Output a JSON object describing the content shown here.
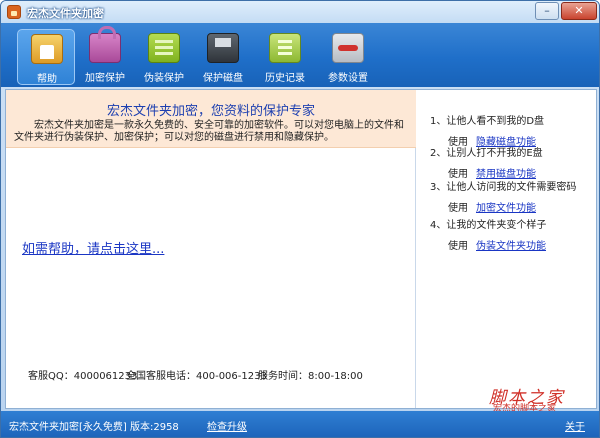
{
  "window": {
    "title": "宏杰文件夹加密"
  },
  "toolbar": {
    "items": [
      {
        "label": "帮助",
        "icon": "home-icon"
      },
      {
        "label": "加密保护",
        "icon": "lock-icon"
      },
      {
        "label": "伪装保护",
        "icon": "book-icon"
      },
      {
        "label": "保护磁盘",
        "icon": "disk-icon"
      },
      {
        "label": "历史记录",
        "icon": "history-icon"
      },
      {
        "label": "参数设置",
        "icon": "toolbox-icon"
      }
    ]
  },
  "banner": {
    "title": "宏杰文件夹加密，您资料的保护专家",
    "text": "宏杰文件夹加密是一款永久免费的、安全可靠的加密软件。可以对您电脑上的文件和文件夹进行伪装保护、加密保护；可以对您的磁盘进行禁用和隐藏保护。"
  },
  "help_link": "如需帮助，请点击这里...",
  "contact": {
    "qq": "客服QQ：4000061233",
    "phone": "全国客服电话：400-006-1233",
    "hours": "服务时间：8:00-18:00"
  },
  "tips": [
    {
      "title": "1、让他人看不到我的D盘",
      "use": "使用",
      "link": "隐藏磁盘功能"
    },
    {
      "title": "2、让别人打不开我的E盘",
      "use": "使用",
      "link": "禁用磁盘功能"
    },
    {
      "title": "3、让他人访问我的文件需要密码",
      "use": "使用",
      "link": "加密文件功能"
    },
    {
      "title": "4、让我的文件夹变个样子",
      "use": "使用",
      "link": "伪装文件夹功能"
    }
  ],
  "watermark": {
    "main": "脚本之家",
    "sub": "宏杰的脚本之家"
  },
  "status": {
    "text": "宏杰文件夹加密[永久免费] 版本:2958",
    "update_link": "检查升级",
    "about_link": "关于"
  },
  "colors": {
    "toolbar": "#1f6fc9",
    "banner": "#fde8d6",
    "link": "#1a36c4",
    "watermark": "#d03028"
  }
}
